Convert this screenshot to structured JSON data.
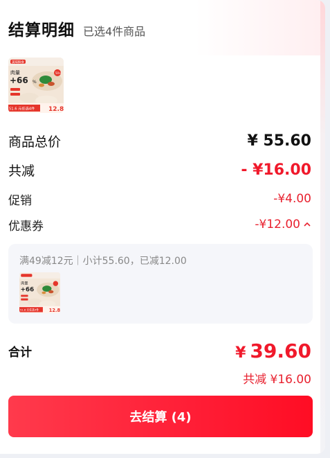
{
  "header": {
    "title": "结算明细",
    "subtitle": "已选4件商品"
  },
  "product": {
    "image_icon": "dumpling-product-thumbnail",
    "thumb_text": {
      "brand": "美味鲜食",
      "meat": "肉量",
      "big": "+66",
      "pct": "%",
      "tag": "50+",
      "promo": "51.6 元任选4件",
      "price": "12.8"
    }
  },
  "summary": {
    "total_label": "商品总价",
    "total_value": "¥ 55.60",
    "reduce_label": "共减",
    "reduce_value": "- ¥16.00",
    "promo_label": "促销",
    "promo_value": "-¥4.00",
    "coupon_label": "优惠券",
    "coupon_value": "-¥12.00"
  },
  "promo_box": {
    "text": "满49减12元｜小计55.60，已减12.00"
  },
  "footer": {
    "sum_label": "合计",
    "sum_yen": "¥",
    "sum_value": "39.60",
    "save_label": "共减 ¥16.00",
    "checkout_label": "去结算 (4)"
  },
  "colors": {
    "accent_red": "#f0192b",
    "panel_bg": "#f5f6fa"
  }
}
